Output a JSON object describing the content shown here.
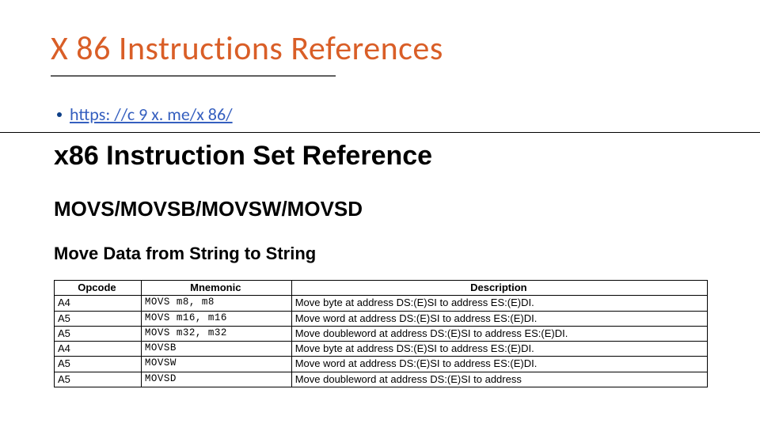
{
  "title": "X 86 Instructions References",
  "bullet": {
    "link": "https: //c 9 x. me/x 86/",
    "href": "https://c9x.me/x86/"
  },
  "ref": {
    "site_title": "x86 Instruction Set Reference",
    "instr_heading": "MOVS/MOVSB/MOVSW/MOVSD",
    "sub_heading": "Move Data from String to String",
    "columns": [
      "Opcode",
      "Mnemonic",
      "Description"
    ],
    "rows": [
      {
        "opcode": "A4",
        "mnemonic": "MOVS m8, m8",
        "desc": "Move byte at address DS:(E)SI to address ES:(E)DI."
      },
      {
        "opcode": "A5",
        "mnemonic": "MOVS m16, m16",
        "desc": "Move word at address DS:(E)SI to address ES:(E)DI."
      },
      {
        "opcode": "A5",
        "mnemonic": "MOVS m32, m32",
        "desc": "Move doubleword at address DS:(E)SI to address ES:(E)DI."
      },
      {
        "opcode": "A4",
        "mnemonic": "MOVSB",
        "desc": "Move byte at address DS:(E)SI to address ES:(E)DI."
      },
      {
        "opcode": "A5",
        "mnemonic": "MOVSW",
        "desc": "Move word at address DS:(E)SI to address ES:(E)DI."
      },
      {
        "opcode": "A5",
        "mnemonic": "MOVSD",
        "desc": "Move doubleword at address DS:(E)SI to address"
      }
    ]
  }
}
